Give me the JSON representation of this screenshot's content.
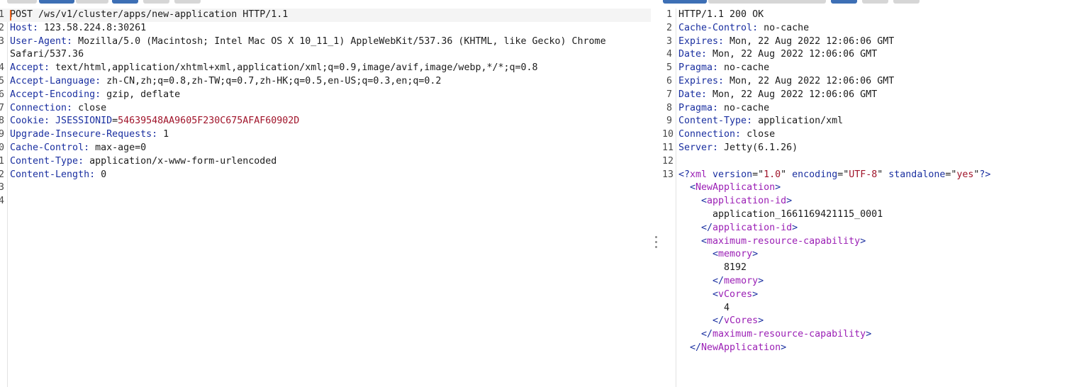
{
  "request": {
    "lines": [
      {
        "n": "1",
        "parts": [
          {
            "t": "POST /ws/v1/cluster/apps/new-application HTTP/1.1",
            "c": "v"
          }
        ]
      },
      {
        "n": "2",
        "parts": [
          {
            "t": "Host:",
            "c": "k"
          },
          {
            "t": " 123.58.224.8:30261",
            "c": "v"
          }
        ]
      },
      {
        "n": "3",
        "parts": [
          {
            "t": "User-Agent:",
            "c": "k"
          },
          {
            "t": " Mozilla/5.0 (Macintosh; Intel Mac OS X 10_11_1) AppleWebKit/537.36 (KHTML, like Gecko) Chrome",
            "c": "v"
          }
        ]
      },
      {
        "n": "",
        "parts": [
          {
            "t": "Safari/537.36",
            "c": "v"
          }
        ]
      },
      {
        "n": "4",
        "parts": [
          {
            "t": "Accept:",
            "c": "k"
          },
          {
            "t": " text/html,application/xhtml+xml,application/xml;q=0.9,image/avif,image/webp,*/*;q=0.8",
            "c": "v"
          }
        ]
      },
      {
        "n": "5",
        "parts": [
          {
            "t": "Accept-Language:",
            "c": "k"
          },
          {
            "t": " zh-CN,zh;q=0.8,zh-TW;q=0.7,zh-HK;q=0.5,en-US;q=0.3,en;q=0.2",
            "c": "v"
          }
        ]
      },
      {
        "n": "6",
        "parts": [
          {
            "t": "Accept-Encoding:",
            "c": "k"
          },
          {
            "t": " gzip, deflate",
            "c": "v"
          }
        ]
      },
      {
        "n": "7",
        "parts": [
          {
            "t": "Connection:",
            "c": "k"
          },
          {
            "t": " close",
            "c": "v"
          }
        ]
      },
      {
        "n": "8",
        "parts": [
          {
            "t": "Cookie:",
            "c": "k"
          },
          {
            "t": " JSESSIONID",
            "c": "k"
          },
          {
            "t": "=",
            "c": "v"
          },
          {
            "t": "54639548AA9605F230C675AFAF60902D",
            "c": "ck"
          }
        ]
      },
      {
        "n": "9",
        "parts": [
          {
            "t": "Upgrade-Insecure-Requests:",
            "c": "k"
          },
          {
            "t": " 1",
            "c": "v"
          }
        ]
      },
      {
        "n": "0",
        "parts": [
          {
            "t": "Cache-Control:",
            "c": "k"
          },
          {
            "t": " max-age=0",
            "c": "v"
          }
        ]
      },
      {
        "n": "1",
        "parts": [
          {
            "t": "Content-Type:",
            "c": "k"
          },
          {
            "t": " application/x-www-form-urlencoded",
            "c": "v"
          }
        ]
      },
      {
        "n": "2",
        "parts": [
          {
            "t": "Content-Length:",
            "c": "k"
          },
          {
            "t": " 0",
            "c": "v"
          }
        ]
      },
      {
        "n": "3",
        "parts": []
      },
      {
        "n": "4",
        "parts": []
      }
    ]
  },
  "response": {
    "lines": [
      {
        "n": "1",
        "parts": [
          {
            "t": "HTTP/1.1 200 OK",
            "c": "v"
          }
        ]
      },
      {
        "n": "2",
        "parts": [
          {
            "t": "Cache-Control:",
            "c": "k"
          },
          {
            "t": " no-cache",
            "c": "v"
          }
        ]
      },
      {
        "n": "3",
        "parts": [
          {
            "t": "Expires:",
            "c": "k"
          },
          {
            "t": " Mon, 22 Aug 2022 12:06:06 GMT",
            "c": "v"
          }
        ]
      },
      {
        "n": "4",
        "parts": [
          {
            "t": "Date:",
            "c": "k"
          },
          {
            "t": " Mon, 22 Aug 2022 12:06:06 GMT",
            "c": "v"
          }
        ]
      },
      {
        "n": "5",
        "parts": [
          {
            "t": "Pragma:",
            "c": "k"
          },
          {
            "t": " no-cache",
            "c": "v"
          }
        ]
      },
      {
        "n": "6",
        "parts": [
          {
            "t": "Expires:",
            "c": "k"
          },
          {
            "t": " Mon, 22 Aug 2022 12:06:06 GMT",
            "c": "v"
          }
        ]
      },
      {
        "n": "7",
        "parts": [
          {
            "t": "Date:",
            "c": "k"
          },
          {
            "t": " Mon, 22 Aug 2022 12:06:06 GMT",
            "c": "v"
          }
        ]
      },
      {
        "n": "8",
        "parts": [
          {
            "t": "Pragma:",
            "c": "k"
          },
          {
            "t": " no-cache",
            "c": "v"
          }
        ]
      },
      {
        "n": "9",
        "parts": [
          {
            "t": "Content-Type:",
            "c": "k"
          },
          {
            "t": " application/xml",
            "c": "v"
          }
        ]
      },
      {
        "n": "10",
        "parts": [
          {
            "t": "Connection:",
            "c": "k"
          },
          {
            "t": " close",
            "c": "v"
          }
        ]
      },
      {
        "n": "11",
        "parts": [
          {
            "t": "Server:",
            "c": "k"
          },
          {
            "t": " Jetty(6.1.26)",
            "c": "v"
          }
        ]
      },
      {
        "n": "12",
        "parts": []
      },
      {
        "n": "13",
        "parts": [
          {
            "t": "<?",
            "c": "br"
          },
          {
            "t": "xml",
            "c": "tg"
          },
          {
            "t": " version",
            "c": "an"
          },
          {
            "t": "=\"",
            "c": "v"
          },
          {
            "t": "1.0",
            "c": "av"
          },
          {
            "t": "\"",
            "c": "v"
          },
          {
            "t": " encoding",
            "c": "an"
          },
          {
            "t": "=\"",
            "c": "v"
          },
          {
            "t": "UTF-8",
            "c": "av"
          },
          {
            "t": "\"",
            "c": "v"
          },
          {
            "t": " standalone",
            "c": "an"
          },
          {
            "t": "=\"",
            "c": "v"
          },
          {
            "t": "yes",
            "c": "av"
          },
          {
            "t": "\"",
            "c": "v"
          },
          {
            "t": "?>",
            "c": "br"
          }
        ]
      },
      {
        "n": "",
        "parts": [
          {
            "t": "  <",
            "c": "br"
          },
          {
            "t": "NewApplication",
            "c": "tg"
          },
          {
            "t": ">",
            "c": "br"
          }
        ]
      },
      {
        "n": "",
        "parts": [
          {
            "t": "    <",
            "c": "br"
          },
          {
            "t": "application-id",
            "c": "tg"
          },
          {
            "t": ">",
            "c": "br"
          }
        ]
      },
      {
        "n": "",
        "parts": [
          {
            "t": "      application_1661169421115_0001",
            "c": "v"
          }
        ]
      },
      {
        "n": "",
        "parts": [
          {
            "t": "    </",
            "c": "br"
          },
          {
            "t": "application-id",
            "c": "tg"
          },
          {
            "t": ">",
            "c": "br"
          }
        ]
      },
      {
        "n": "",
        "parts": [
          {
            "t": "    <",
            "c": "br"
          },
          {
            "t": "maximum-resource-capability",
            "c": "tg"
          },
          {
            "t": ">",
            "c": "br"
          }
        ]
      },
      {
        "n": "",
        "parts": [
          {
            "t": "      <",
            "c": "br"
          },
          {
            "t": "memory",
            "c": "tg"
          },
          {
            "t": ">",
            "c": "br"
          }
        ]
      },
      {
        "n": "",
        "parts": [
          {
            "t": "        8192",
            "c": "v"
          }
        ]
      },
      {
        "n": "",
        "parts": [
          {
            "t": "      </",
            "c": "br"
          },
          {
            "t": "memory",
            "c": "tg"
          },
          {
            "t": ">",
            "c": "br"
          }
        ]
      },
      {
        "n": "",
        "parts": [
          {
            "t": "      <",
            "c": "br"
          },
          {
            "t": "vCores",
            "c": "tg"
          },
          {
            "t": ">",
            "c": "br"
          }
        ]
      },
      {
        "n": "",
        "parts": [
          {
            "t": "        4",
            "c": "v"
          }
        ]
      },
      {
        "n": "",
        "parts": [
          {
            "t": "      </",
            "c": "br"
          },
          {
            "t": "vCores",
            "c": "tg"
          },
          {
            "t": ">",
            "c": "br"
          }
        ]
      },
      {
        "n": "",
        "parts": [
          {
            "t": "    </",
            "c": "br"
          },
          {
            "t": "maximum-resource-capability",
            "c": "tg"
          },
          {
            "t": ">",
            "c": "br"
          }
        ]
      },
      {
        "n": "",
        "parts": [
          {
            "t": "  </",
            "c": "br"
          },
          {
            "t": "NewApplication",
            "c": "tg"
          },
          {
            "t": ">",
            "c": "br"
          }
        ]
      }
    ]
  },
  "colors": {
    "header_key": "#1a2fa0",
    "xml_tag": "#9b1fb5",
    "attr_value": "#a0142a",
    "caret": "#e8641e",
    "toolbar_active": "#3d6fb5"
  }
}
